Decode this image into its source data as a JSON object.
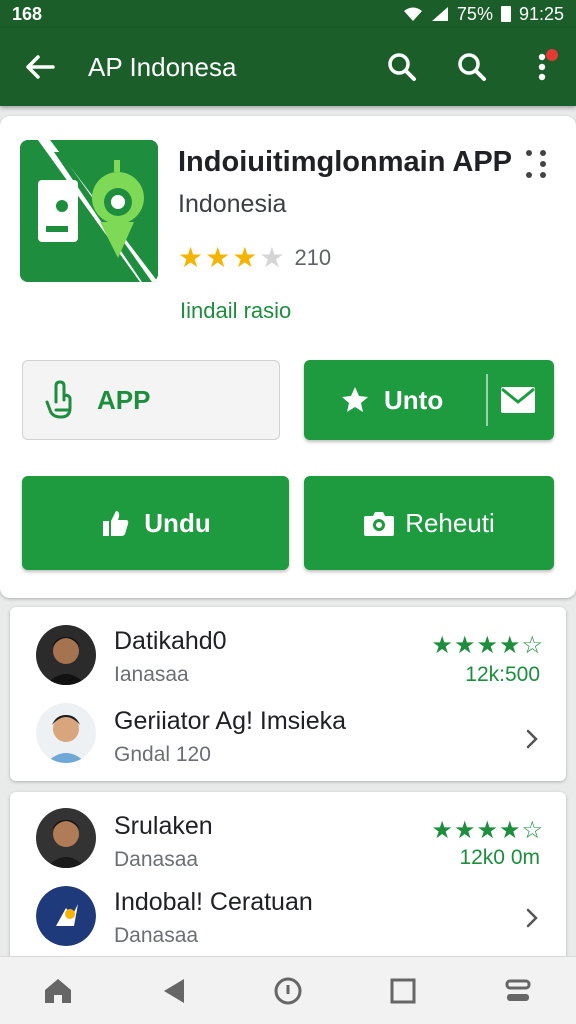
{
  "status_bar": {
    "left": "168",
    "battery": "75%",
    "time": "91:25"
  },
  "app_bar": {
    "title": "AP Indonesa"
  },
  "app": {
    "name": "Indoiuitimglonmain APP",
    "developer": "Indonesia",
    "rating": 3.5,
    "rating_count": "210",
    "link": "Iindail rasio"
  },
  "buttons": {
    "app": "APP",
    "unto": "Unto",
    "undu": "Undu",
    "reheuti": "Reheuti"
  },
  "reviews": [
    {
      "name": "Datikahd0",
      "sub": "Ianasaa",
      "stars": "★★★★☆",
      "meta": "12k:500"
    },
    {
      "name": "Geriiator Ag! Imsieka",
      "sub": "Gndal 120"
    },
    {
      "name": "Srulaken",
      "sub": "Danasaa",
      "stars": "★★★★☆",
      "meta": "12k0 0m"
    },
    {
      "name": "Indobal! Ceratuan",
      "sub": "Danasaa"
    }
  ],
  "colors": {
    "primary_dark": "#1b5e2a",
    "accent_green": "#1e9a3f",
    "star_gold": "#f4b400"
  },
  "icons": [
    "back-arrow-icon",
    "search-icon",
    "more-vert-icon",
    "home-icon",
    "back-icon",
    "assistant-icon",
    "recents-icon",
    "menu-icon"
  ]
}
